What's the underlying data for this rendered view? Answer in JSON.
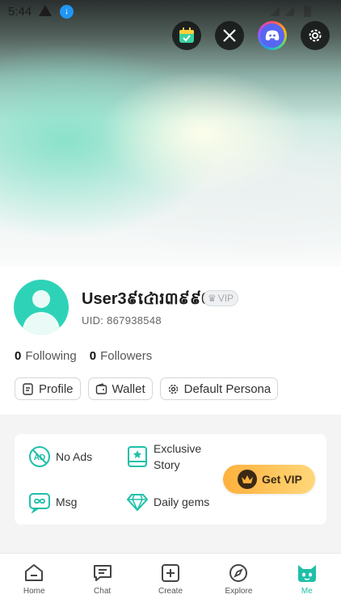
{
  "status_bar": {
    "time": "5:44",
    "download_glyph": "↓"
  },
  "top_icons": [
    "calendar-check-icon",
    "x-logo-icon",
    "discord-icon",
    "settings-gear-icon"
  ],
  "profile": {
    "username": "User3៩៤ោរ៣៩៩0",
    "vip_badge": "VIP",
    "uid": "UID: 867938548",
    "following_count": "0",
    "following_label": "Following",
    "followers_count": "0",
    "followers_label": "Followers"
  },
  "pills": {
    "profile": "Profile",
    "wallet": "Wallet",
    "default_persona": "Default Persona"
  },
  "vip_card": {
    "no_ads": "No Ads",
    "exclusive_story": "Exclusive Story",
    "msg": "Msg",
    "daily_gems": "Daily gems",
    "get_vip": "Get VIP"
  },
  "tabs": [
    "Home",
    "Chat",
    "Create",
    "Explore",
    "Me"
  ],
  "colors": {
    "accent": "#1ec0a8",
    "vip_gold": "#ffb13d"
  }
}
